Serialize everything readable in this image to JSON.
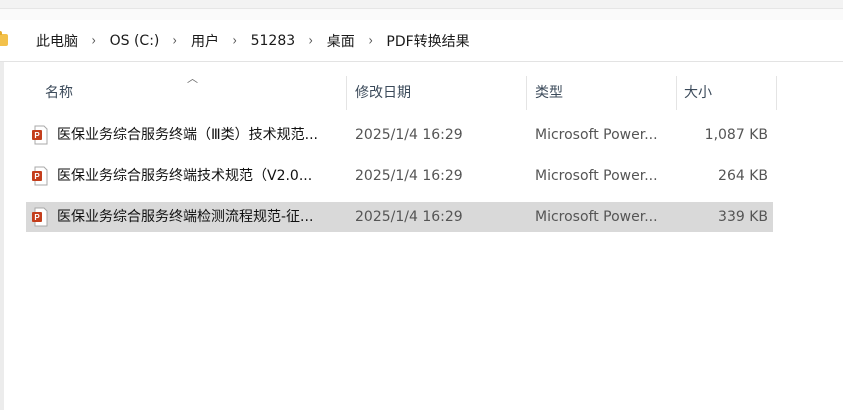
{
  "breadcrumb": {
    "items": [
      "此电脑",
      "OS (C:)",
      "用户",
      "51283",
      "桌面",
      "PDF转换结果"
    ],
    "separator": "›"
  },
  "columns": {
    "name": "名称",
    "date": "修改日期",
    "type": "类型",
    "size": "大小"
  },
  "files": [
    {
      "name": "医保业务综合服务终端（Ⅲ类）技术规范...",
      "date": "2025/1/4 16:29",
      "type": "Microsoft Power...",
      "size": "1,087 KB",
      "selected": false
    },
    {
      "name": "医保业务综合服务终端技术规范（V2.0...",
      "date": "2025/1/4 16:29",
      "type": "Microsoft Power...",
      "size": "264 KB",
      "selected": false
    },
    {
      "name": "医保业务综合服务终端检测流程规范-征...",
      "date": "2025/1/4 16:29",
      "type": "Microsoft Power...",
      "size": "339 KB",
      "selected": true
    }
  ],
  "icons": {
    "file": "powerpoint-file-icon",
    "folder": "folder-icon",
    "sort": "sort-ascending-icon"
  },
  "colors": {
    "selected_row": "#d9d9d9",
    "ppt_red": "#c43e1c",
    "folder_yellow": "#f3c14b"
  }
}
